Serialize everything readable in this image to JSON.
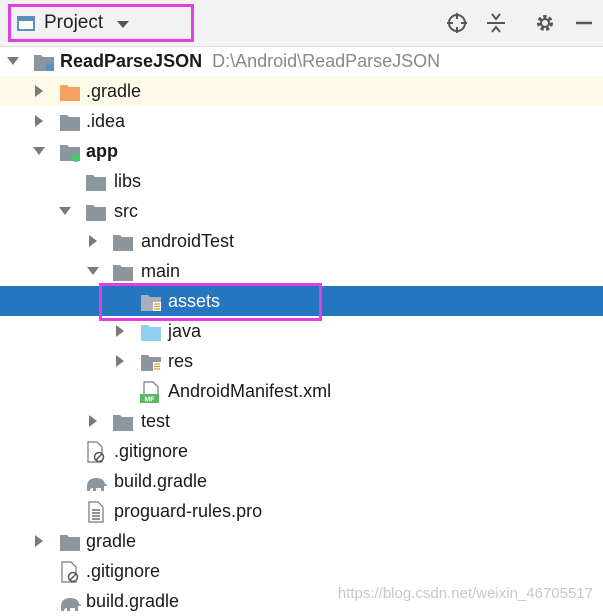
{
  "toolbar": {
    "view_label": "Project",
    "icons": [
      "locate-icon",
      "collapse-all-icon",
      "settings-gear-icon",
      "minimize-icon"
    ]
  },
  "tree": {
    "root": {
      "label": "ReadParseJSON",
      "path": "D:\\Android\\ReadParseJSON"
    },
    "items": [
      {
        "label": ".gradle"
      },
      {
        "label": ".idea"
      },
      {
        "label": "app"
      },
      {
        "label": "libs"
      },
      {
        "label": "src"
      },
      {
        "label": "androidTest"
      },
      {
        "label": "main"
      },
      {
        "label": "assets"
      },
      {
        "label": "java"
      },
      {
        "label": "res"
      },
      {
        "label": "AndroidManifest.xml"
      },
      {
        "label": "test"
      },
      {
        "label": ".gitignore"
      },
      {
        "label": "build.gradle"
      },
      {
        "label": "proguard-rules.pro"
      },
      {
        "label": "gradle"
      },
      {
        "label": ".gitignore"
      },
      {
        "label": "build.gradle"
      }
    ],
    "manifest_badge": "MF"
  },
  "watermark": "https://blog.csdn.net/weixin_46705517",
  "colors": {
    "selection": "#2675bf",
    "highlight_box": "#e23ee2",
    "folder": "#8c969e",
    "source_folder": "#8fd0f2",
    "excluded_folder": "#f4a261"
  }
}
